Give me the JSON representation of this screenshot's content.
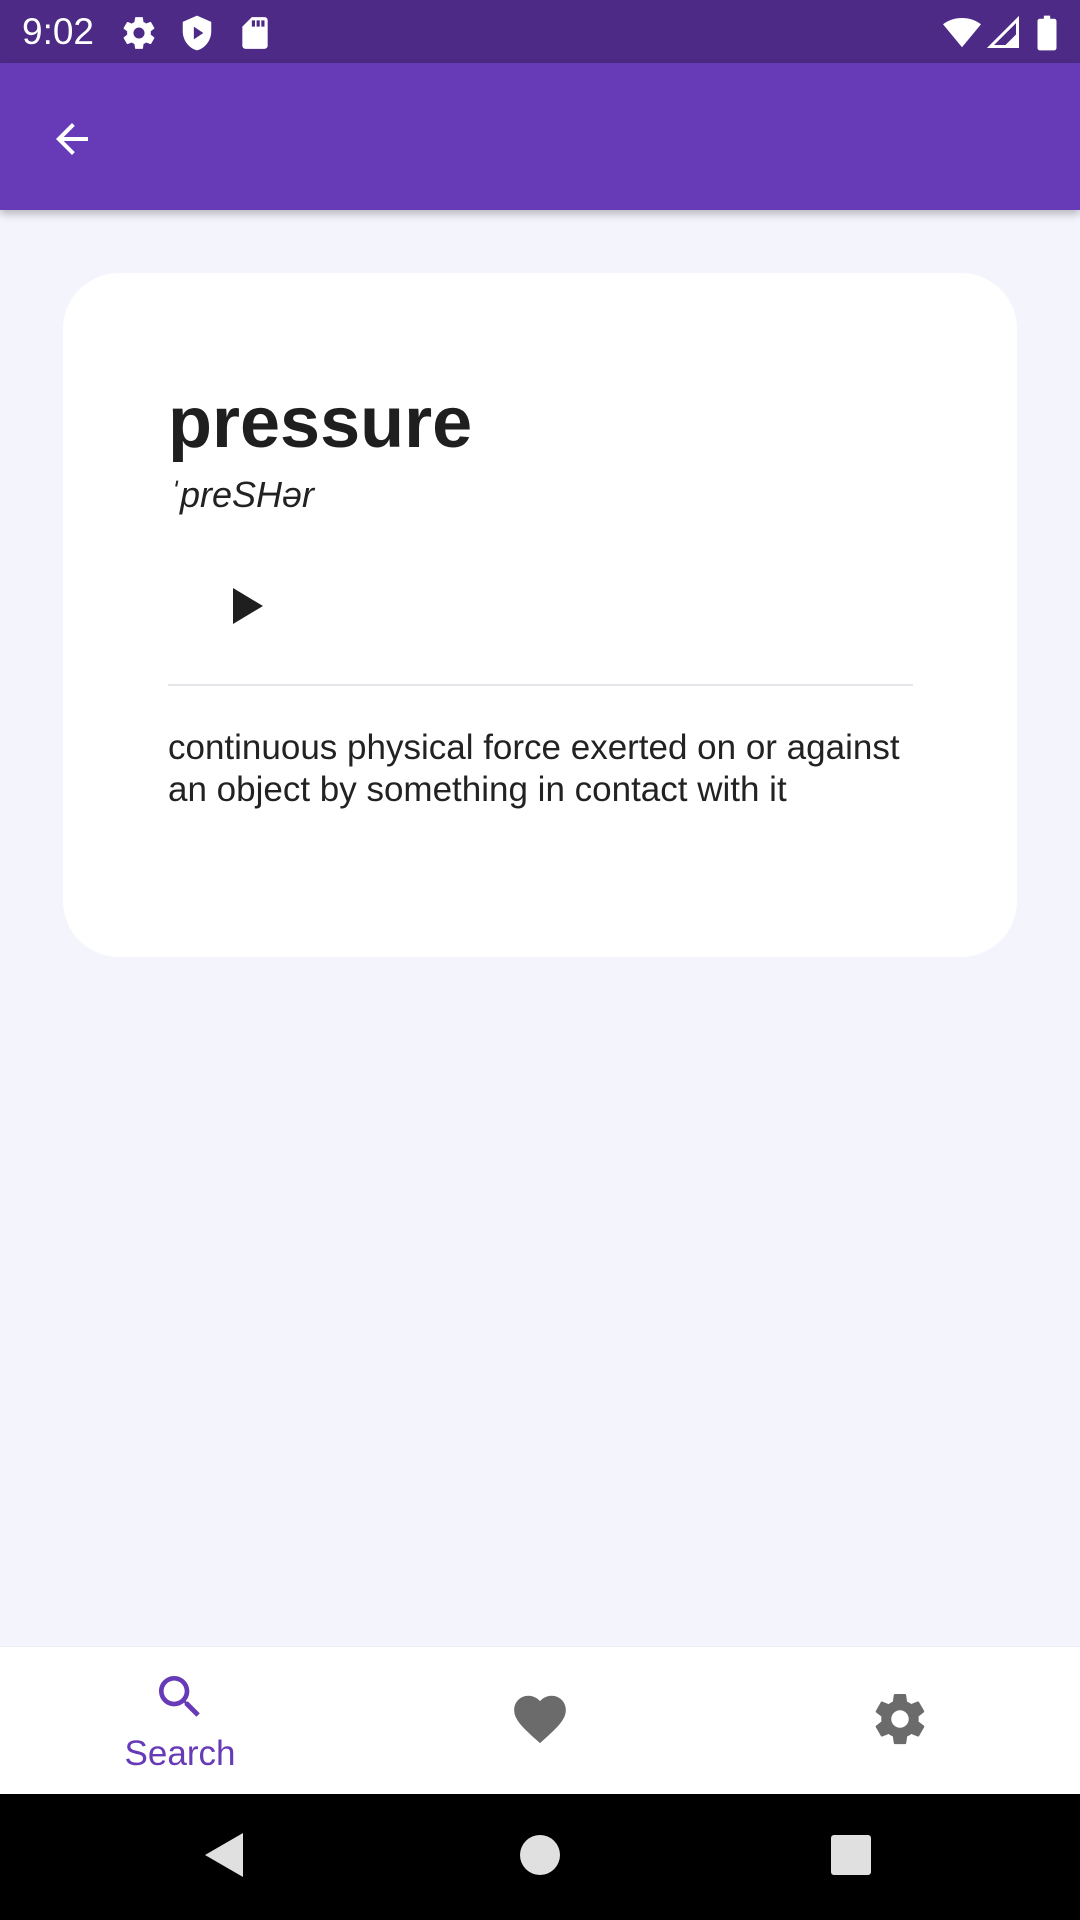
{
  "status_bar": {
    "time": "9:02",
    "left_icons": [
      "settings-icon",
      "shield-icon",
      "sd-card-icon"
    ],
    "right_icons": [
      "wifi-icon",
      "cellular-signal-icon",
      "battery-icon"
    ]
  },
  "app_bar": {
    "back_icon": "arrow-back-icon",
    "color": "#673ab7"
  },
  "card": {
    "word": "pressure",
    "phonetic": "ˈpreSHər",
    "play_icon": "play-icon",
    "definition": "continuous physical force exerted on or against an object by something in contact with it"
  },
  "bottom_nav": {
    "items": [
      {
        "icon": "search-icon",
        "label": "Search",
        "active": true
      },
      {
        "icon": "heart-icon",
        "label": "",
        "active": false
      },
      {
        "icon": "gear-icon",
        "label": "",
        "active": false
      }
    ],
    "active_color": "#673ab7",
    "inactive_color": "#6b6b6b"
  },
  "system_nav": {
    "buttons": [
      "back-triangle-icon",
      "home-circle-icon",
      "recents-square-icon"
    ]
  }
}
